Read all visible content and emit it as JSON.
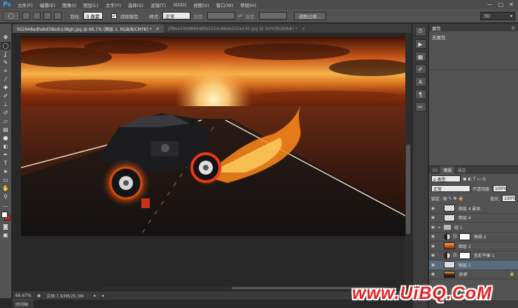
{
  "app": {
    "logo": "Ps"
  },
  "menu": [
    "文件(F)",
    "编辑(E)",
    "图像(I)",
    "图层(L)",
    "文字(Y)",
    "选择(S)",
    "滤镜(T)",
    "3D(D)",
    "视图(V)",
    "窗口(W)",
    "帮助(H)"
  ],
  "window_controls": [
    "—",
    "□",
    "✕"
  ],
  "options": {
    "feather_label": "羽化:",
    "feather_value": "0 像素",
    "antialias_label": "消除锯齿",
    "style_label": "样式:",
    "style_value": "正常",
    "width_label": "宽度:",
    "height_label": "高度:",
    "refine_button": "调整边缘...",
    "workspace": "3D"
  },
  "tabs": [
    {
      "label": "002948adhebd38sdcs38gh.jpg @ 66.7% (图层 1, RGB/8/CMYK) *",
      "close": "×"
    },
    {
      "label": "2f84a50b9840d8fe2554c864e502e140.jpg @ 50%(RGB/8#) *",
      "close": "×"
    }
  ],
  "status": {
    "zoom": "66.67%",
    "doc": "文档:7.93M/25.3M",
    "bottom_tab": "时间轴"
  },
  "properties": {
    "title": "属性",
    "content": "无属性"
  },
  "layers_panel": {
    "tabs": [
      "3D",
      "图层",
      "通道"
    ],
    "filter_label": "ρ 类型",
    "blend_mode": "正常",
    "opacity_label": "不透明度:",
    "opacity_value": "100%",
    "lock_label": "锁定:",
    "fill_label": "填充:",
    "fill_value": "100%",
    "layers": [
      {
        "name": "图层 4 副本",
        "kind": "checker"
      },
      {
        "name": "图层 4",
        "kind": "checker"
      },
      {
        "name": "组 1",
        "kind": "folder"
      },
      {
        "name": "曲线 2",
        "kind": "adjust"
      },
      {
        "name": "图层 2",
        "kind": "fire"
      },
      {
        "name": "色彩平衡 1",
        "kind": "adjust"
      },
      {
        "name": "图层 1",
        "kind": "checker",
        "selected": true
      },
      {
        "name": "背景",
        "kind": "bg",
        "locked": true
      }
    ]
  },
  "watermark": "www.UiBQ.CoM",
  "icons": {
    "tools": [
      "move-icon",
      "marquee-icon",
      "lasso-icon",
      "quick-select-icon",
      "crop-icon",
      "eyedropper-icon",
      "healing-icon",
      "brush-icon",
      "stamp-icon",
      "history-brush-icon",
      "eraser-icon",
      "gradient-icon",
      "blur-icon",
      "dodge-icon",
      "pen-icon",
      "type-icon",
      "path-select-icon",
      "shape-icon",
      "hand-icon",
      "zoom-icon"
    ],
    "strip": [
      "history-icon",
      "actions-icon",
      "swatches-icon",
      "brushes-icon",
      "character-icon",
      "paragraph-icon",
      "tools-icon"
    ]
  }
}
